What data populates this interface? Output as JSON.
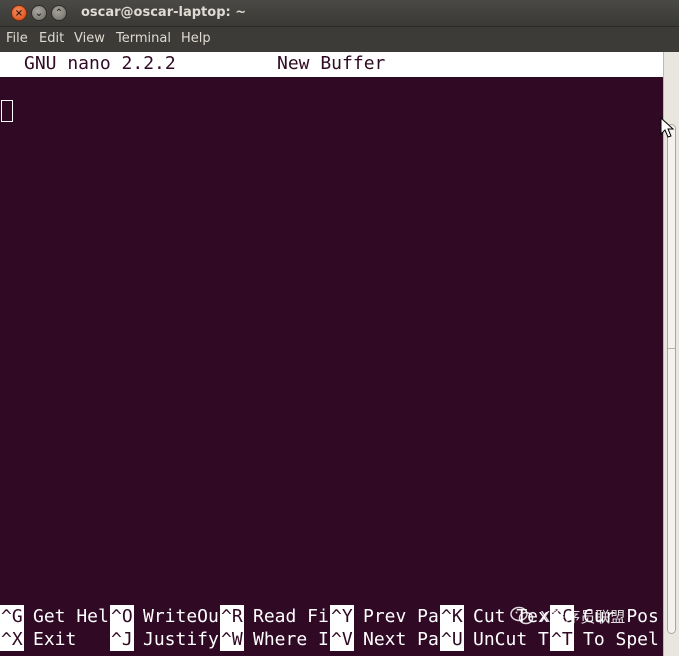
{
  "window": {
    "title": "oscar@oscar-laptop: ~",
    "close": "×",
    "minimize": "⌄",
    "maximize": "⌃"
  },
  "menu": {
    "items": [
      "File",
      "Edit",
      "View",
      "Terminal",
      "Help"
    ]
  },
  "nano": {
    "version": "GNU nano 2.2.2",
    "buffer": "New Buffer"
  },
  "shortcuts": {
    "row1": [
      {
        "key": "^G",
        "label": "Get Hel"
      },
      {
        "key": "^O",
        "label": "WriteOu"
      },
      {
        "key": "^R",
        "label": "Read Fi"
      },
      {
        "key": "^Y",
        "label": "Prev Pa"
      },
      {
        "key": "^K",
        "label": "Cut Tex"
      },
      {
        "key": "^C",
        "label": "Cur Pos"
      }
    ],
    "row2": [
      {
        "key": "^X",
        "label": "Exit"
      },
      {
        "key": "^J",
        "label": "Justify"
      },
      {
        "key": "^W",
        "label": "Where I"
      },
      {
        "key": "^V",
        "label": "Next Pa"
      },
      {
        "key": "^U",
        "label": "UnCut T"
      },
      {
        "key": "^T",
        "label": "To Spel"
      }
    ]
  },
  "watermark": {
    "text": "X程序员联盟",
    "icon": "wechat-icon"
  },
  "colors": {
    "terminal_bg": "#300a24",
    "chrome_bg": "#3c3b37",
    "close_button": "#e0561f"
  }
}
